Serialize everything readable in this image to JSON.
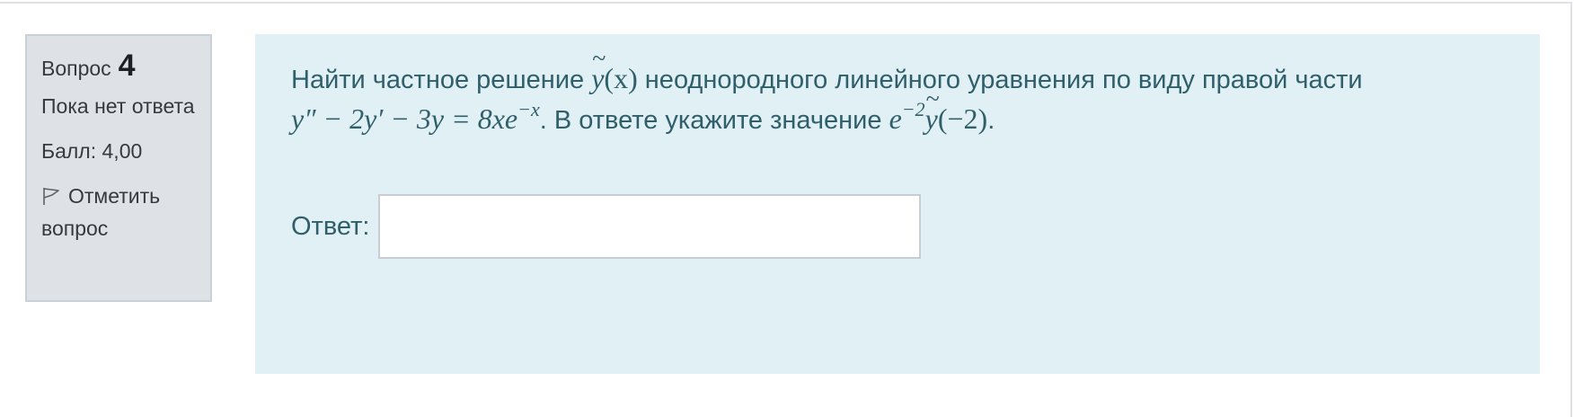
{
  "question_info": {
    "label": "Вопрос",
    "number": "4",
    "state": "Пока нет ответа",
    "grade": "Балл: 4,00",
    "flag_label": "Отметить вопрос",
    "flag_icon": "flag-icon"
  },
  "question": {
    "text_part1": "Найти частное решение",
    "func": "y",
    "func_arg": "(x)",
    "text_part2": "неоднородного линейного уравнения по виду правой части",
    "equation": "y″ − 2y′ − 3y = 8xe",
    "equation_exp": "−x",
    "text_part3": ". В ответе укажите значение",
    "value_base": "e",
    "value_exp": "−2",
    "value_func": "y",
    "value_arg": "(−2)",
    "end": "."
  },
  "answer": {
    "label": "Ответ:",
    "value": "",
    "placeholder": ""
  },
  "colors": {
    "info_bg": "#dee2e6",
    "content_bg": "#e1f0f5",
    "text": "#2f5f6a"
  }
}
